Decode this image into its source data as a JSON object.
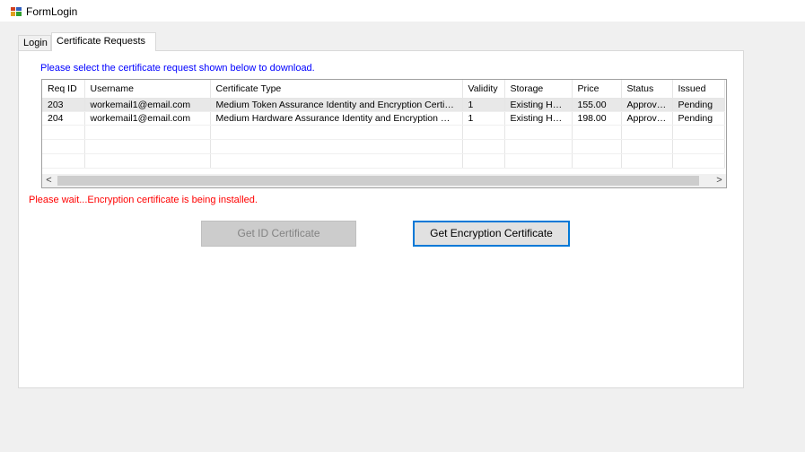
{
  "window": {
    "title": "FormLogin"
  },
  "tabs": [
    {
      "label": "Login"
    },
    {
      "label": "Certificate Requests"
    }
  ],
  "panel": {
    "instruction": "Please select the certificate request shown below to download.",
    "status_message": "Please wait...Encryption certificate is being installed."
  },
  "table": {
    "columns": [
      "Req ID",
      "Username",
      "Certificate Type",
      "Validity",
      "Storage",
      "Price",
      "Status",
      "Issued"
    ],
    "rows": [
      [
        "203",
        "workemail1@email.com",
        "Medium Token Assurance Identity and Encryption Certificate",
        "1",
        "Existing Har...",
        "155.00",
        "Approved",
        "Pending"
      ],
      [
        "204",
        "workemail1@email.com",
        "Medium Hardware Assurance Identity and Encryption Certifi...",
        "1",
        "Existing Har...",
        "198.00",
        "Approved",
        "Pending"
      ]
    ]
  },
  "scrollbar": {
    "left_arrow": "<",
    "right_arrow": ">"
  },
  "buttons": {
    "get_id": "Get ID Certificate",
    "get_encryption": "Get Encryption Certificate"
  }
}
